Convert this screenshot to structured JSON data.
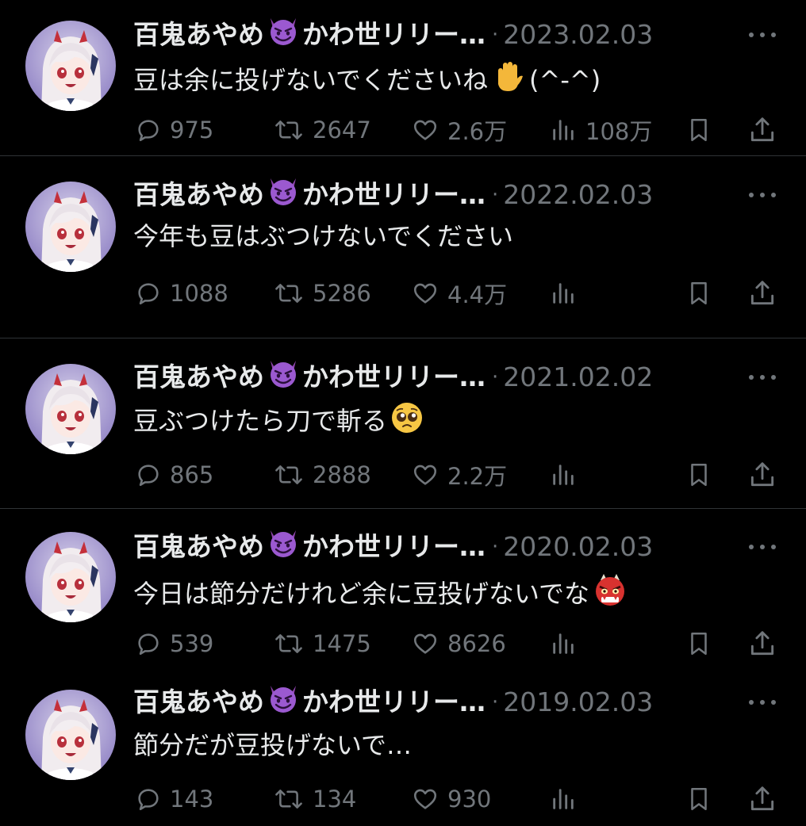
{
  "tweets": [
    {
      "name": "百鬼あやめ",
      "name_suffix": "かわ世リリー…",
      "date": "2023.02.03",
      "text": "豆は余に投げないでくださいね",
      "text_emoji": "raised-hand",
      "text_tail": "(^-^)",
      "replies": "975",
      "retweets": "2647",
      "likes": "2.6万",
      "views": "108万"
    },
    {
      "name": "百鬼あやめ",
      "name_suffix": "かわ世リリー…",
      "date": "2022.02.03",
      "text": "今年も豆はぶつけないでください",
      "text_emoji": "",
      "text_tail": "",
      "replies": "1088",
      "retweets": "5286",
      "likes": "4.4万",
      "views": ""
    },
    {
      "name": "百鬼あやめ",
      "name_suffix": "かわ世リリー…",
      "date": "2021.02.02",
      "text": "豆ぶつけたら刀で斬る",
      "text_emoji": "pleading-face",
      "text_tail": "",
      "replies": "865",
      "retweets": "2888",
      "likes": "2.2万",
      "views": ""
    },
    {
      "name": "百鬼あやめ",
      "name_suffix": "かわ世リリー…",
      "date": "2020.02.03",
      "text": "今日は節分だけれど余に豆投げないでな",
      "text_emoji": "ogre",
      "text_tail": "",
      "replies": "539",
      "retweets": "1475",
      "likes": "8626",
      "views": ""
    },
    {
      "name": "百鬼あやめ",
      "name_suffix": "かわ世リリー…",
      "date": "2019.02.03",
      "text": "節分だが豆投げないで…",
      "text_emoji": "",
      "text_tail": "",
      "replies": "143",
      "retweets": "134",
      "likes": "930",
      "views": ""
    }
  ],
  "theme": {
    "background": "#000000",
    "text": "#e7e9ea",
    "muted": "#71767b",
    "divider": "#2f3336",
    "devil_emoji": "#9b59d0"
  },
  "icons": {
    "reply": "speech-bubble-icon",
    "retweet": "retweet-arrows-icon",
    "like": "heart-icon",
    "views": "bar-chart-icon",
    "bookmark": "bookmark-icon",
    "share": "share-upload-icon",
    "more": "ellipsis-icon"
  }
}
